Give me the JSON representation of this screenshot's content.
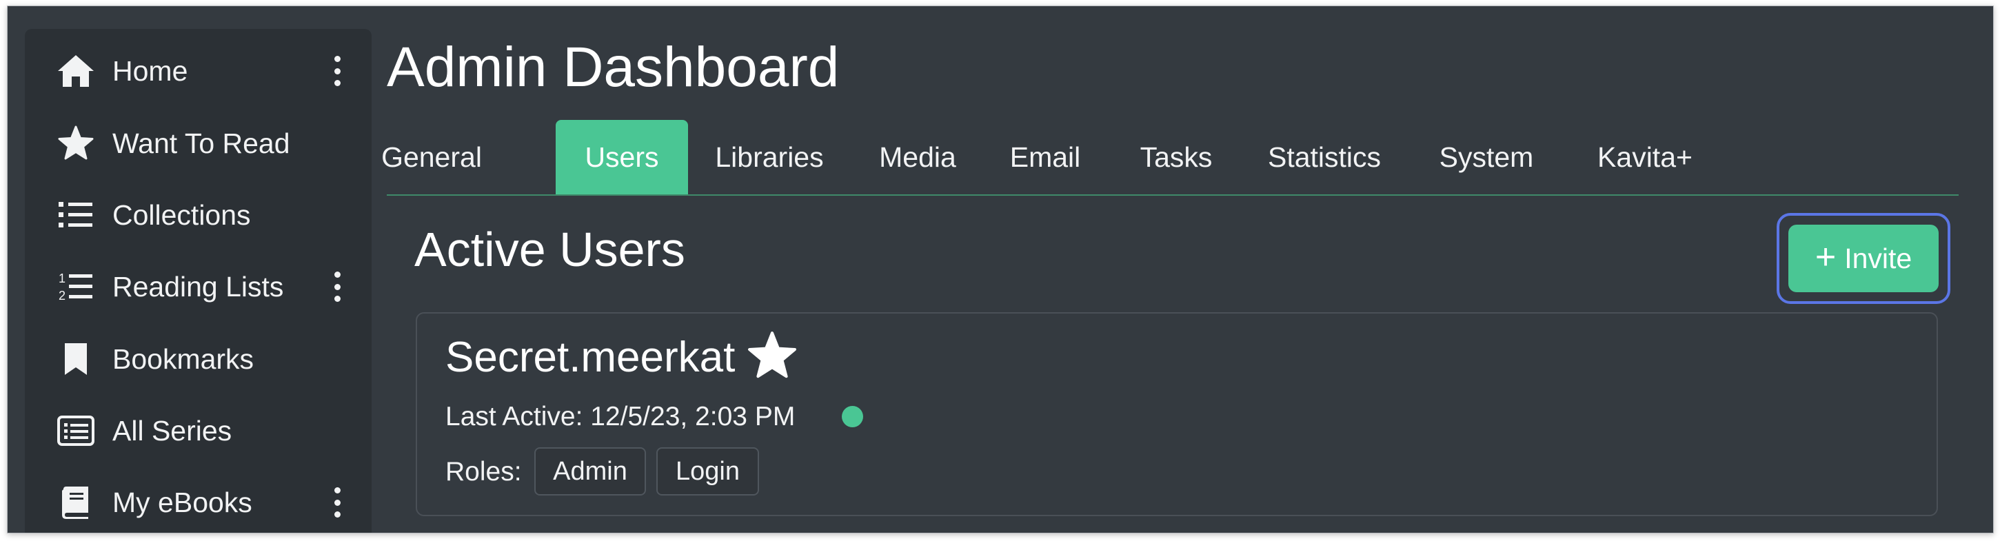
{
  "sidebar": {
    "items": [
      {
        "label": "Home",
        "icon": "home-icon",
        "has_menu": true
      },
      {
        "label": "Want To Read",
        "icon": "star-icon",
        "has_menu": false
      },
      {
        "label": "Collections",
        "icon": "list-icon",
        "has_menu": false
      },
      {
        "label": "Reading Lists",
        "icon": "numbered-list-icon",
        "has_menu": true
      },
      {
        "label": "Bookmarks",
        "icon": "bookmark-icon",
        "has_menu": false
      },
      {
        "label": "All Series",
        "icon": "series-list-icon",
        "has_menu": false
      },
      {
        "label": "My eBooks",
        "icon": "book-icon",
        "has_menu": true
      }
    ]
  },
  "page": {
    "title": "Admin Dashboard"
  },
  "tabs": [
    {
      "label": "General",
      "active": false
    },
    {
      "label": "Users",
      "active": true
    },
    {
      "label": "Libraries",
      "active": false
    },
    {
      "label": "Media",
      "active": false
    },
    {
      "label": "Email",
      "active": false
    },
    {
      "label": "Tasks",
      "active": false
    },
    {
      "label": "Statistics",
      "active": false
    },
    {
      "label": "System",
      "active": false
    },
    {
      "label": "Kavita+",
      "active": false
    }
  ],
  "section": {
    "title": "Active Users",
    "invite_label": "Invite",
    "invite_icon": "plus-icon"
  },
  "user": {
    "name": "Secret.meerkat",
    "badge_icon": "star-icon",
    "last_active_label": "Last Active:",
    "last_active_value": "12/5/23, 2:03 PM",
    "status": "online",
    "roles_label": "Roles:",
    "roles": [
      "Admin",
      "Login"
    ]
  },
  "colors": {
    "background": "#343a40",
    "sidebar": "#2b3035",
    "accent": "#4ac694",
    "focus_ring": "#5b76e6",
    "text": "#f2f3f4"
  }
}
